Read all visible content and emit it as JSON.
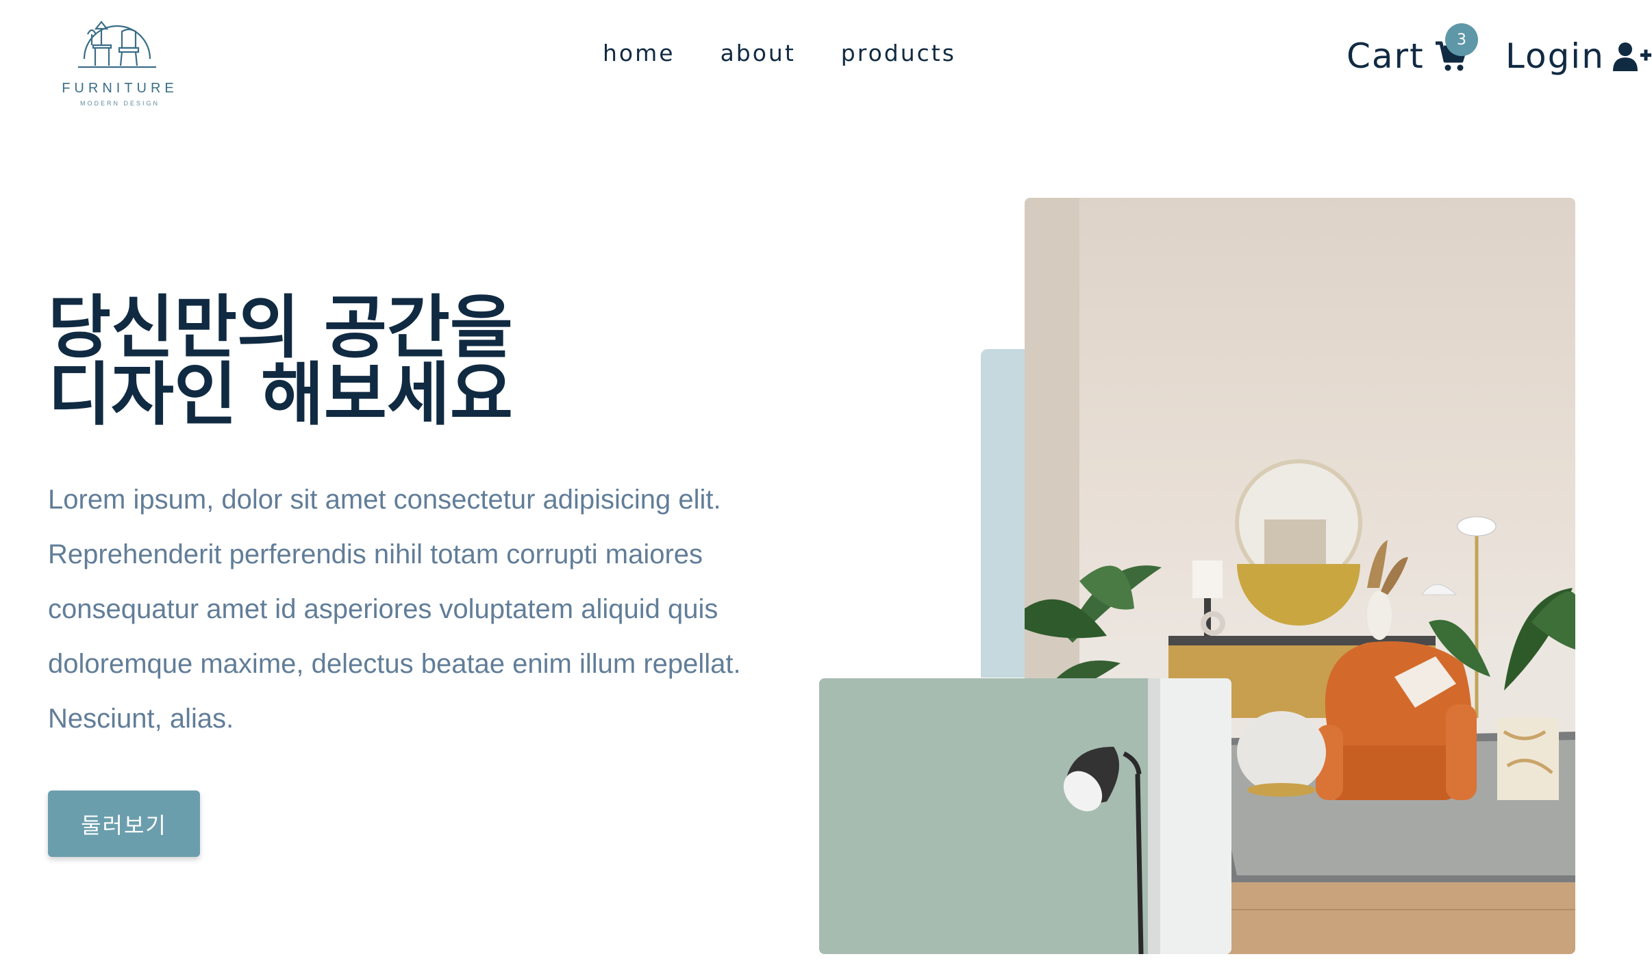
{
  "brand": {
    "name": "FURNITURE",
    "tagline": "MODERN DESIGN",
    "primary_color": "#6b9ead",
    "text_color": "#102a42"
  },
  "nav": {
    "links": [
      {
        "label": "home",
        "icon": "none"
      },
      {
        "label": "about",
        "icon": "none"
      },
      {
        "label": "products",
        "icon": "none"
      }
    ],
    "cart_label": "Cart",
    "cart_count": "3",
    "cart_icon": "shopping-cart-icon",
    "login_label": "Login",
    "login_icon": "user-plus-icon"
  },
  "hero": {
    "title_line1": "당신만의 공간을",
    "title_line2": "디자인 해보세요",
    "description": "Lorem ipsum, dolor sit amet consectetur adipisicing elit. Reprehenderit perferendis nihil totam corrupti maiores consequatur amet id asperiores voluptatem aliquid quis doloremque maxime, delectus beatae enim illum repellat. Nesciunt, alias.",
    "button_label": "둘러보기"
  }
}
